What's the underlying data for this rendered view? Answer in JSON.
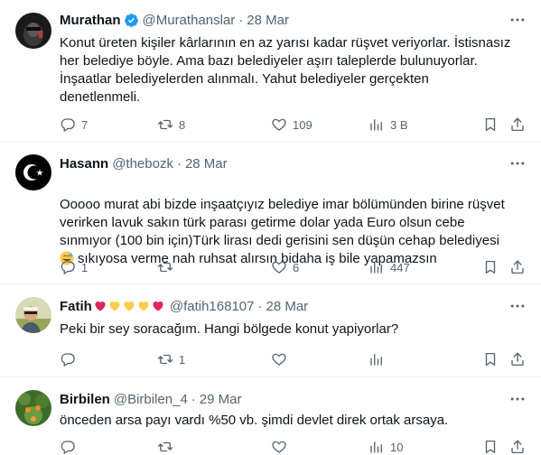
{
  "tweets": [
    {
      "name": "Murathan",
      "handle": "@Murathanslar",
      "date": "28 Mar",
      "verified": true,
      "text": "Konut üreten kişiler kârlarının en az yarısı kadar rüşvet veriyorlar. İstisnasız\nher belediye böyle. Ama bazı belediyeler aşırı taleplerde bulunuyorlar.\nİnşaatlar belediyelerden alınmalı. Yahut belediyeler gerçekten\ndenetlenmeli.",
      "replies": "7",
      "retweets": "8",
      "likes": "109",
      "views": "3 B"
    },
    {
      "name": "Hasann",
      "handle": "@thebozk",
      "date": "28 Mar",
      "verified": false,
      "text": "Ooooo murat abi bizde inşaatçıyız belediye imar bölümünden birine rüşvet\nverirken lavuk sakın türk parası getirme dolar yada Euro olsun cebe\nsınmıyor (100 bin için)Türk lirası dedi gerisini sen düşün cehap belediyesi",
      "text_last": "sıkıyosa verme nah ruhsat alırsın bidaha iş bile yapamazsın",
      "emoji": "sweat-smile-emoji",
      "replies": "1",
      "retweets": "",
      "likes": "6",
      "views": "447"
    },
    {
      "name": "Fatih",
      "handle": "@fatih168107",
      "date": "28 Mar",
      "verified": false,
      "heart_colors": [
        "#e0245e",
        "#ffcc4d",
        "#ffcc4d",
        "#ffcc4d",
        "#e0245e"
      ],
      "text": "Peki bir sey soracağım. Hangi bölgede konut yapiyorlar?",
      "replies": "",
      "retweets": "1",
      "likes": "",
      "views": ""
    },
    {
      "name": "Birbilen",
      "handle": "@Birbilen_4",
      "date": "29 Mar",
      "verified": false,
      "text": "önceden arsa payı vardı %50 vb. şimdi devlet direk ortak arsaya.",
      "replies": "",
      "retweets": "",
      "likes": "",
      "views": "10"
    }
  ],
  "icons": {
    "reply": "reply-icon",
    "retweet": "retweet-icon",
    "like": "heart-icon",
    "views": "views-icon",
    "bookmark": "bookmark-icon",
    "share": "share-icon",
    "more": "more-icon",
    "verified": "verified-badge-icon"
  },
  "colors": {
    "text": "#0f1419",
    "secondary": "#536471",
    "verified": "#1d9bf0",
    "divider": "#eff3f4"
  }
}
